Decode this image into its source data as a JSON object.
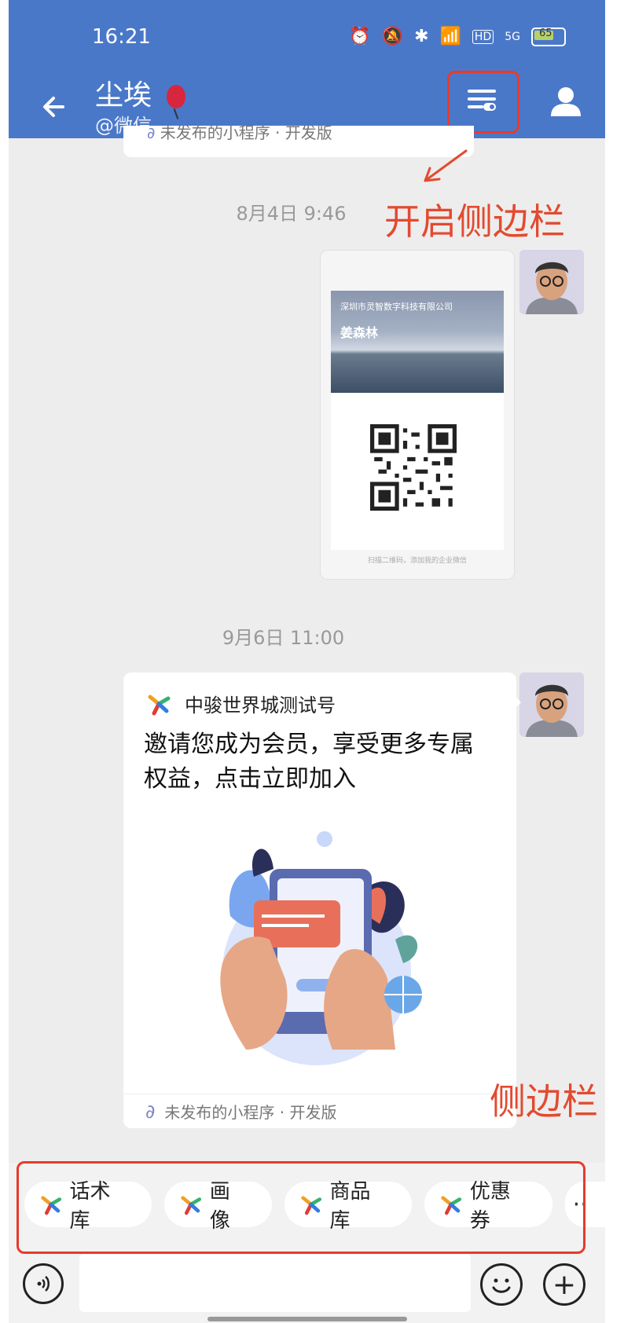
{
  "status_bar": {
    "time": "16:21",
    "network": "5G",
    "hd": "HD",
    "battery": "65"
  },
  "header": {
    "title": "尘埃",
    "subtitle": "@微信"
  },
  "previous_card": {
    "footer_label": "未发布的小程序 · 开发版"
  },
  "timestamps": {
    "first": "8月4日  9:46",
    "second": "9月6日  11:00"
  },
  "business_card": {
    "company": "深圳市灵智数字科技有限公司",
    "person": "姜森林",
    "hint": "扫描二维码，添加我的企业微信"
  },
  "mini_program_card": {
    "source": "中骏世界城测试号",
    "message": "邀请您成为会员，享受更多专属权益，点击立即加入",
    "footer_label": "未发布的小程序 · 开发版"
  },
  "annotations": {
    "open_sidebar": "开启侧边栏",
    "sidebar": "侧边栏"
  },
  "sidebar_tools": [
    {
      "label": "话术库",
      "icon": "app-logo-icon"
    },
    {
      "label": "画像",
      "icon": "app-logo-icon"
    },
    {
      "label": "商品库",
      "icon": "app-logo-icon"
    },
    {
      "label": "优惠券",
      "icon": "app-logo-icon"
    }
  ],
  "input_bar": {
    "message_placeholder": ""
  },
  "colors": {
    "header": "#4a78c9",
    "annotation": "#e34a2f",
    "background": "#ededed"
  }
}
